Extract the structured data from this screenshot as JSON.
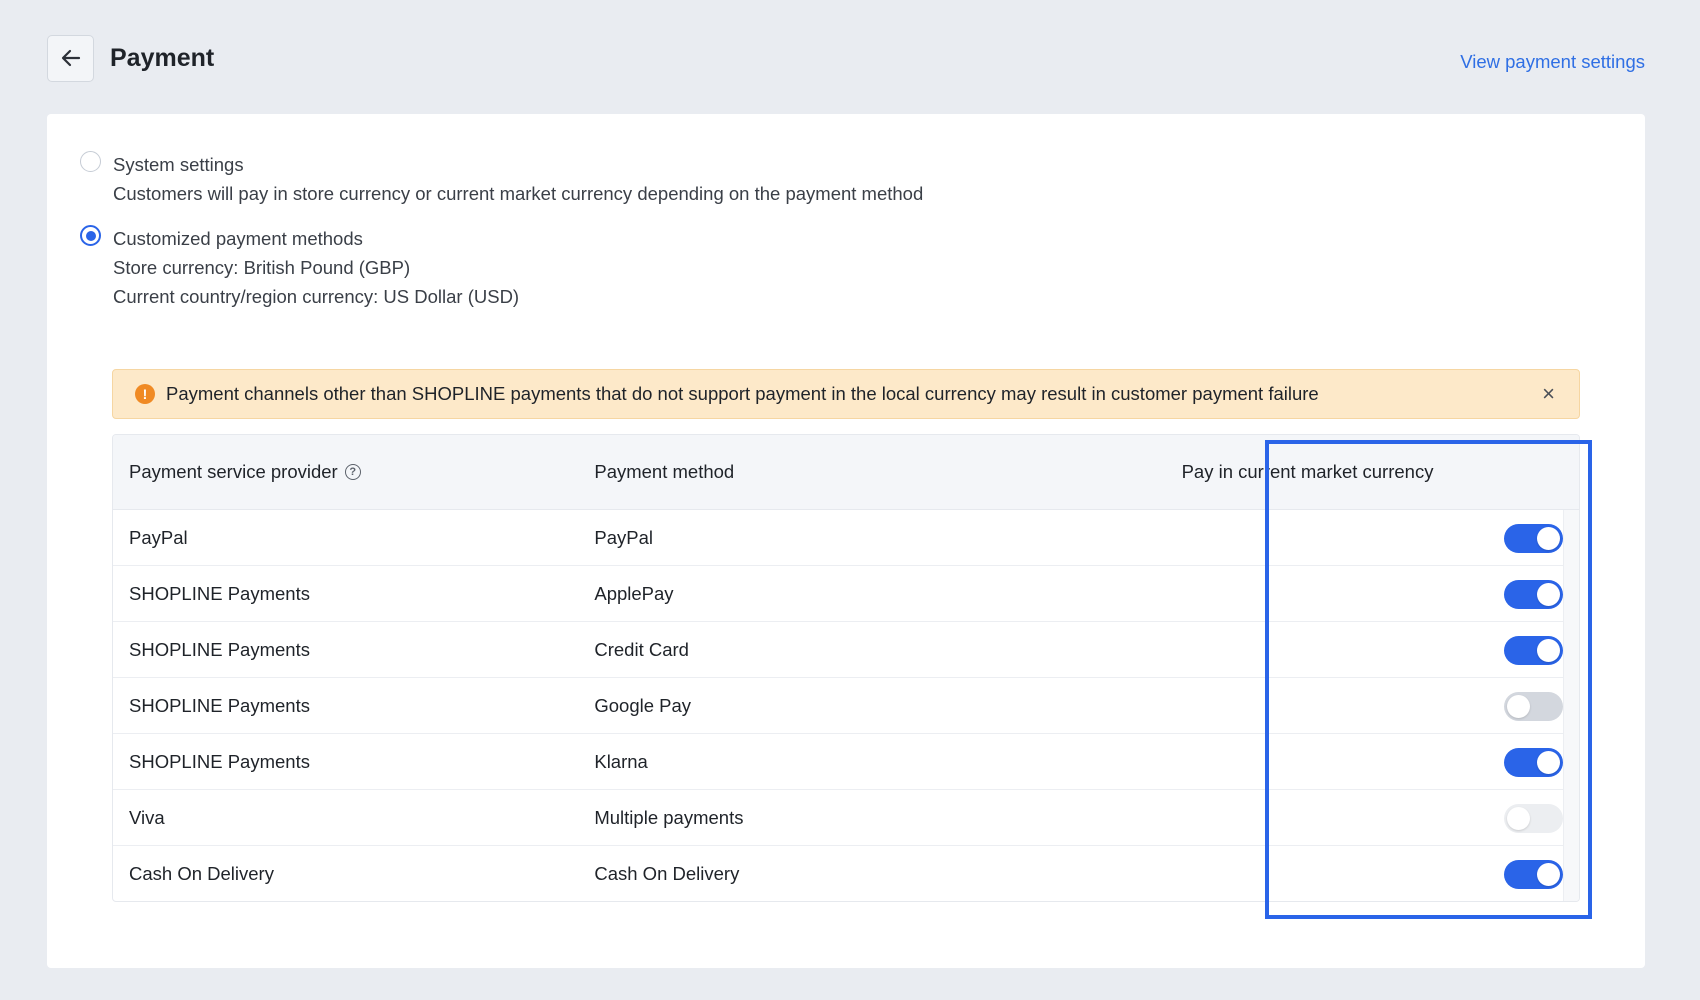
{
  "header": {
    "title": "Payment",
    "settings_link": "View payment settings"
  },
  "options": [
    {
      "label": "System settings",
      "description": "Customers will pay in store currency or current market currency depending on the payment method",
      "selected": false
    },
    {
      "label": "Customized payment methods",
      "store_currency": "Store currency: British Pound (GBP)",
      "region_currency": "Current country/region currency: US Dollar (USD)",
      "selected": true
    }
  ],
  "alert": {
    "icon": "!",
    "text": "Payment channels other than SHOPLINE payments that do not support payment in the local currency may result in customer payment failure",
    "close": "×"
  },
  "table": {
    "columns": [
      "Payment service provider",
      "Payment method",
      "Pay in current market currency"
    ],
    "rows": [
      {
        "provider": "PayPal",
        "method": "PayPal",
        "enabled": true,
        "disabled": false
      },
      {
        "provider": "SHOPLINE Payments",
        "method": "ApplePay",
        "enabled": true,
        "disabled": false
      },
      {
        "provider": "SHOPLINE Payments",
        "method": "Credit Card",
        "enabled": true,
        "disabled": false
      },
      {
        "provider": "SHOPLINE Payments",
        "method": "Google Pay",
        "enabled": false,
        "disabled": false
      },
      {
        "provider": "SHOPLINE Payments",
        "method": "Klarna",
        "enabled": true,
        "disabled": false
      },
      {
        "provider": "Viva",
        "method": "Multiple payments",
        "enabled": false,
        "disabled": true
      },
      {
        "provider": "Cash On Delivery",
        "method": "Cash On Delivery",
        "enabled": true,
        "disabled": false
      }
    ]
  },
  "colors": {
    "accent": "#2a64e8",
    "link": "#2f6fe4",
    "warning_bg": "#fde9c9",
    "warning_icon": "#f08a24"
  },
  "icons": {
    "back": "arrow-left-icon",
    "help": "question-circle-icon",
    "alert": "exclamation-circle-icon",
    "close": "close-icon",
    "help_glyph": "?"
  }
}
